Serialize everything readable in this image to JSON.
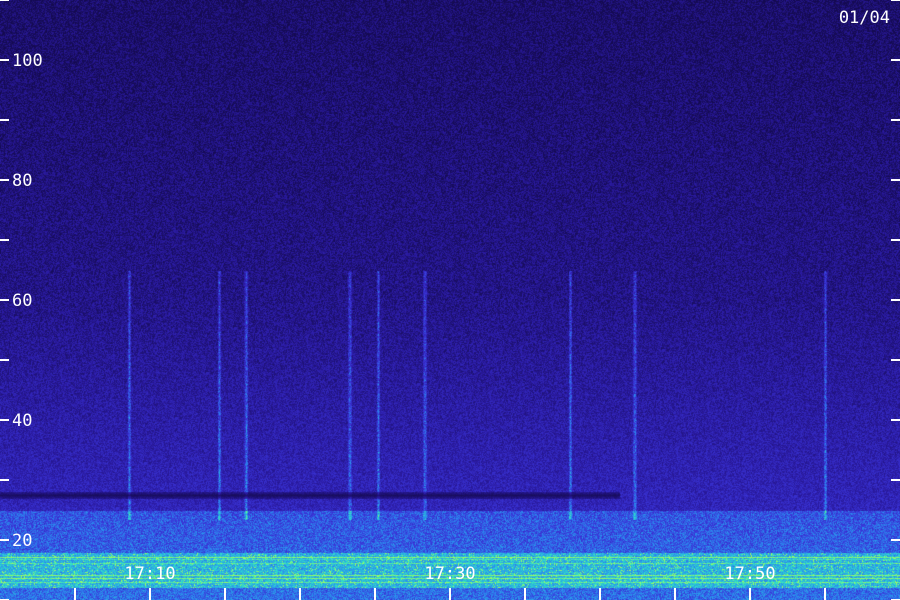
{
  "chart_data": {
    "type": "heatmap",
    "title": "",
    "date_label": "01/04",
    "xlabel": "",
    "ylabel": "",
    "x_start": "17:00",
    "x_end": "17:59",
    "x_minor_tick_minutes": 5,
    "x_labeled_ticks": [
      {
        "minutes": 10,
        "label": "17:10"
      },
      {
        "minutes": 30,
        "label": "17:30"
      },
      {
        "minutes": 50,
        "label": "17:50"
      }
    ],
    "ylim": [
      10,
      110
    ],
    "y_minor_tick_step": 10,
    "y_labeled_ticks": [
      {
        "value": 100,
        "label": "100"
      },
      {
        "value": 80,
        "label": "80"
      },
      {
        "value": 60,
        "label": "60"
      },
      {
        "value": 40,
        "label": "40"
      },
      {
        "value": 20,
        "label": "20"
      }
    ],
    "colormap": [
      "#140a50",
      "#2a1aa0",
      "#3a34d8",
      "#2a8ef0",
      "#2ee0c8",
      "#9cff60"
    ],
    "features": {
      "dark_band_center": 27.5,
      "noise_band_top": 25,
      "strong_band_range": [
        12,
        18
      ],
      "vertical_bursts_minutes": [
        8.6,
        14.6,
        16.4,
        23.3,
        25.2,
        28.3,
        38.0,
        42.3,
        55.0
      ]
    },
    "grid": false,
    "legend": "none"
  }
}
